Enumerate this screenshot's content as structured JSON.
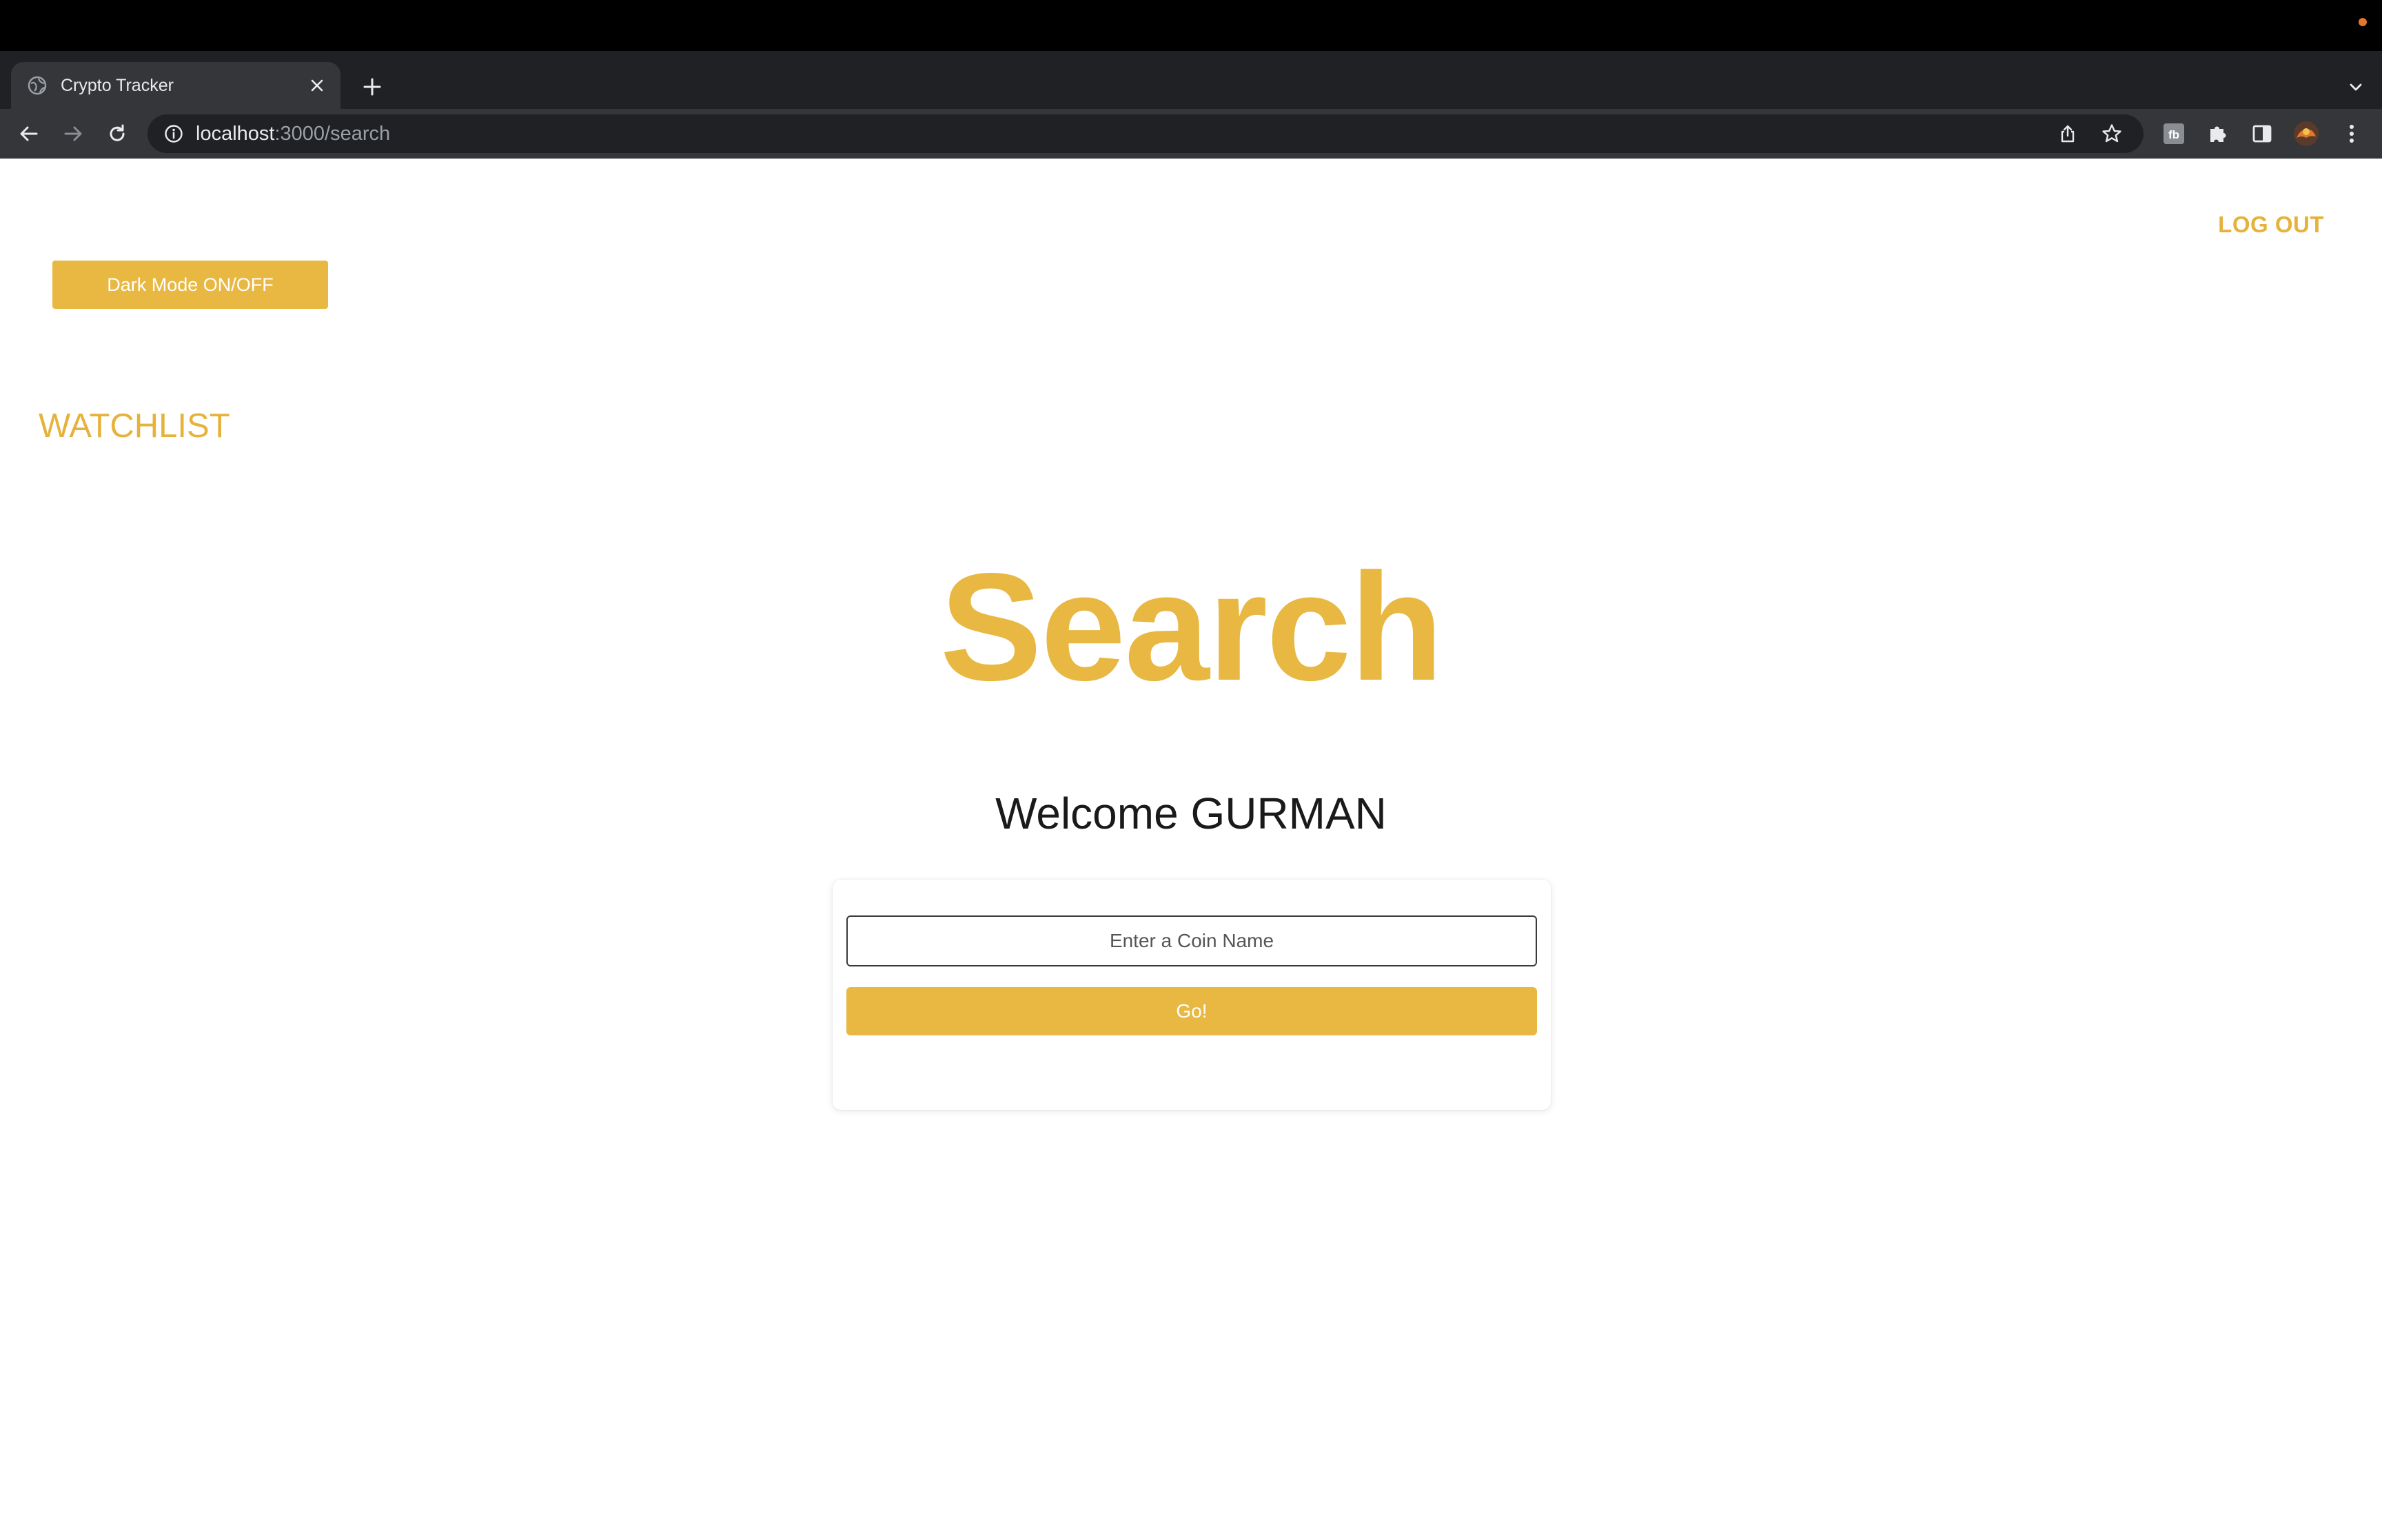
{
  "browser": {
    "tab": {
      "title": "Crypto Tracker"
    },
    "address_bar": {
      "host": "localhost",
      "path": ":3000/search"
    },
    "icons": {
      "favicon": "globe-icon",
      "close": "close-icon",
      "new_tab": "plus-icon",
      "tab_search": "chevron-down-icon",
      "back": "back-arrow-icon",
      "forward": "forward-arrow-icon",
      "reload": "reload-icon",
      "site_info": "info-icon",
      "share": "share-icon",
      "bookmark": "star-icon",
      "extensions": "puzzle-icon",
      "side_panel": "side-panel-icon",
      "profile": "avatar-icon",
      "menu": "kebab-menu-icon"
    }
  },
  "header": {
    "logout_label": "LOG OUT",
    "dark_mode_label": "Dark Mode ON/OFF",
    "watchlist_label": "WATCHLIST"
  },
  "main": {
    "title": "Search",
    "welcome_prefix": "Welcome",
    "user_name": "GURMAN",
    "search": {
      "placeholder": "Enter a Coin Name",
      "value": "",
      "submit_label": "Go!"
    }
  },
  "colors": {
    "accent": "#e8b842",
    "link": "#e6b23b",
    "text": "#1a1a1a",
    "chrome_dark": "#202124",
    "chrome_toolbar": "#35363a"
  }
}
